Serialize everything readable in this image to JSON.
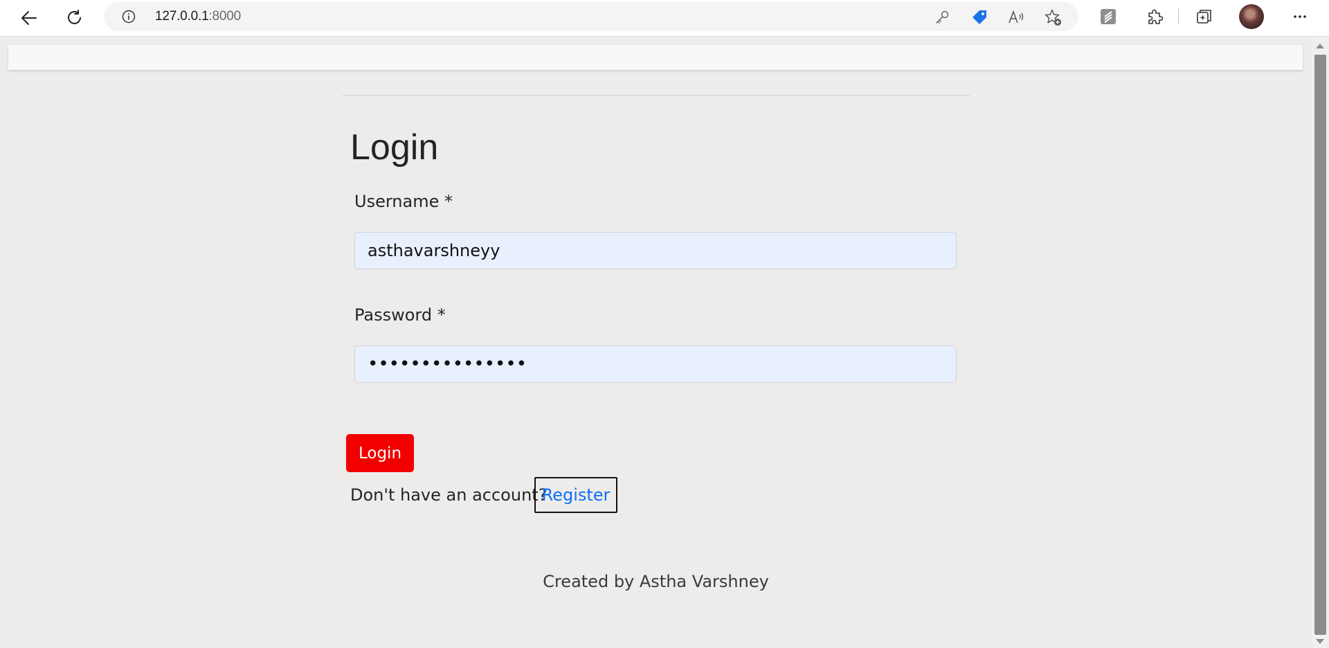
{
  "browser": {
    "url_host": "127.0.0.1",
    "url_port": ":8000",
    "icons": {
      "back": "back-arrow-icon",
      "refresh": "refresh-icon",
      "site_info": "info-icon",
      "password": "key-icon",
      "shopping": "price-tag-icon",
      "read_aloud": "read-aloud-icon",
      "favorites": "add-favorite-icon",
      "extension1": "extension-app-icon",
      "extensions": "puzzle-icon",
      "collections": "collections-icon",
      "menu": "more-dots-icon"
    }
  },
  "login_form": {
    "title": "Login",
    "username_label": "Username *",
    "username_value": "asthavarshneyy",
    "password_label": "Password *",
    "password_value": "•••••••••••••••",
    "submit_label": "Login",
    "no_account_text": "Don't have an account?",
    "register_link": "Register"
  },
  "footer": {
    "text": "Created by Astha Varshney"
  },
  "colors": {
    "page_bg": "#edecea",
    "button_bg": "#f20000",
    "link": "#0d6efd",
    "input_bg": "#e8f0fe"
  }
}
